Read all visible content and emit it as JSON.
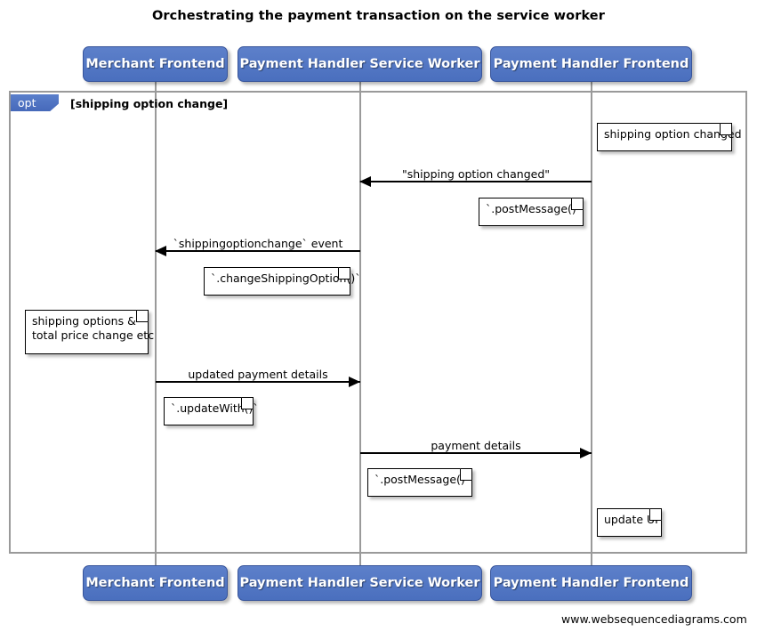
{
  "title": "Orchestrating the payment transaction on the service worker",
  "footer": {
    "credit": "www.websequencediagrams.com"
  },
  "participants": [
    {
      "id": "merchant-frontend",
      "label": "Merchant Frontend"
    },
    {
      "id": "payment-handler-service-worker",
      "label": "Payment Handler Service Worker"
    },
    {
      "id": "payment-handler-frontend",
      "label": "Payment Handler Frontend"
    }
  ],
  "fragment": {
    "operator": "opt",
    "guard": "[shipping option change]"
  },
  "messages": [
    {
      "id": "shipping-option-changed",
      "label": "\"shipping option changed\"",
      "from": "payment-handler-frontend",
      "to": "payment-handler-service-worker",
      "direction": "left"
    },
    {
      "id": "shippingoptionchange-event",
      "label": "`shippingoptionchange` event",
      "from": "payment-handler-service-worker",
      "to": "merchant-frontend",
      "direction": "left"
    },
    {
      "id": "updated-payment-details",
      "label": "updated payment details",
      "from": "merchant-frontend",
      "to": "payment-handler-service-worker",
      "direction": "right"
    },
    {
      "id": "payment-details",
      "label": "payment details",
      "from": "payment-handler-service-worker",
      "to": "payment-handler-frontend",
      "direction": "right"
    }
  ],
  "notes": [
    {
      "id": "note-shipping-option-changed",
      "text": "shipping option changed"
    },
    {
      "id": "note-post-message-1",
      "text": "`.postMessage()`"
    },
    {
      "id": "note-change-shipping-option",
      "text": "`.changeShippingOption()`"
    },
    {
      "id": "note-shipping-options-total-price",
      "text": "shipping options &\ntotal price change etc"
    },
    {
      "id": "note-update-with",
      "text": "`.updateWith()`"
    },
    {
      "id": "note-post-message-2",
      "text": "`.postMessage()`"
    },
    {
      "id": "note-update-ui",
      "text": "update UI"
    }
  ],
  "colors": {
    "participant_fill": "#5579c6",
    "participant_border": "#37549a",
    "fragment_tab": "#4f74c4",
    "frame_border": "#9a9a9a",
    "lifeline": "#9a9a9a",
    "arrow": "#000000",
    "note_fill": "#ffffff",
    "text": "#000000"
  }
}
